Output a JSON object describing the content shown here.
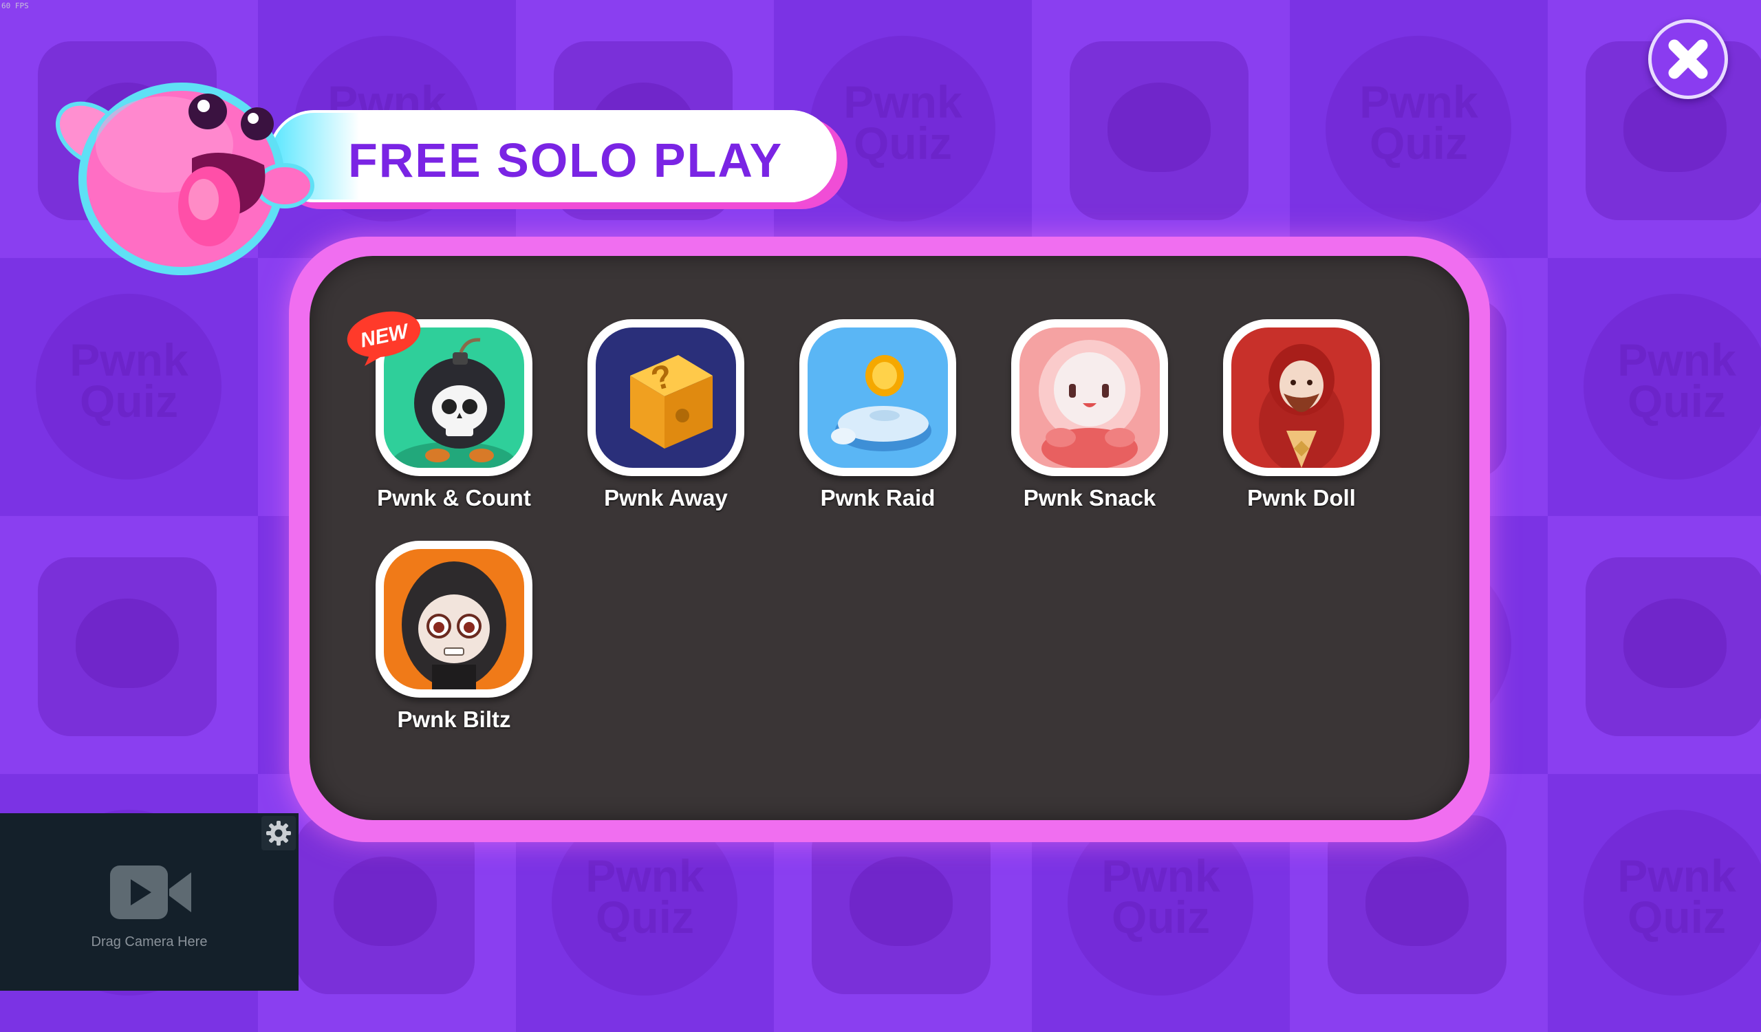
{
  "banner": {
    "title": "FREE SOLO PLAY"
  },
  "background": {
    "tile_word_line1": "Pwnk",
    "tile_word_line2": "Quiz"
  },
  "games": [
    {
      "name": "Pwnk & Count",
      "icon": "bomb-skull-icon",
      "badge": "NEW",
      "bg": "#2fcf9a"
    },
    {
      "name": "Pwnk Away",
      "icon": "question-block-icon",
      "bg": "#2a2f7a"
    },
    {
      "name": "Pwnk Raid",
      "icon": "coin-platform-icon",
      "bg": "#5ab6f5"
    },
    {
      "name": "Pwnk Snack",
      "icon": "astronaut-icon",
      "bg": "#f5a2a2"
    },
    {
      "name": "Pwnk Doll",
      "icon": "matryoshka-icon",
      "bg": "#c8302a"
    },
    {
      "name": "Pwnk Biltz",
      "icon": "hooded-character-icon",
      "bg": "#f07a18"
    }
  ],
  "camera": {
    "label": "Drag Camera Here"
  },
  "colors": {
    "accent": "#7a24e4",
    "panel": "#3a3536",
    "panel_border": "#f06ef0",
    "background": "#7d36e6"
  }
}
